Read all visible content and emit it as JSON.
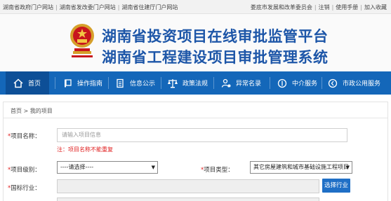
{
  "topbar": {
    "links_left": [
      "湖南省政府门户网站",
      "湖南省发改委门户网站",
      "湖南省住建厅门户网站"
    ],
    "user": "娄底市发展和改革委员会",
    "logout": "注销",
    "manual": "使用手册",
    "favorite": "加入收藏"
  },
  "header": {
    "title_line1": "湖南省投资项目在线审批监管平台",
    "title_line2": "湖南省工程建设项目审批管理系统",
    "emblem_icon": "national-emblem-icon",
    "title_color": "#1d56a8"
  },
  "nav": {
    "color": "#1467b9",
    "items": [
      {
        "label": "首页",
        "icon": "home-icon"
      },
      {
        "label": "操作指南",
        "icon": "guide-icon"
      },
      {
        "label": "信息公示",
        "icon": "document-icon"
      },
      {
        "label": "政策法规",
        "icon": "scales-icon"
      },
      {
        "label": "异常名录",
        "icon": "user-alert-icon"
      },
      {
        "label": "中介服务",
        "icon": "service-icon"
      },
      {
        "label": "市政公用服务",
        "icon": "public-service-icon"
      }
    ]
  },
  "breadcrumb": "首页 > 我的项目",
  "form": {
    "project_name": {
      "label": "项目名称：",
      "placeholder": "请输入项目信息",
      "hint": "注：项目名称不能重复"
    },
    "project_level": {
      "label": "项目级别：",
      "value": "----请选择----"
    },
    "project_type": {
      "label": "项目类型：",
      "value": "其它房屋建筑和城市基础设施工程项目"
    },
    "industry": {
      "label": "国标行业：",
      "button": "选择行业"
    },
    "required_mark": "*"
  }
}
